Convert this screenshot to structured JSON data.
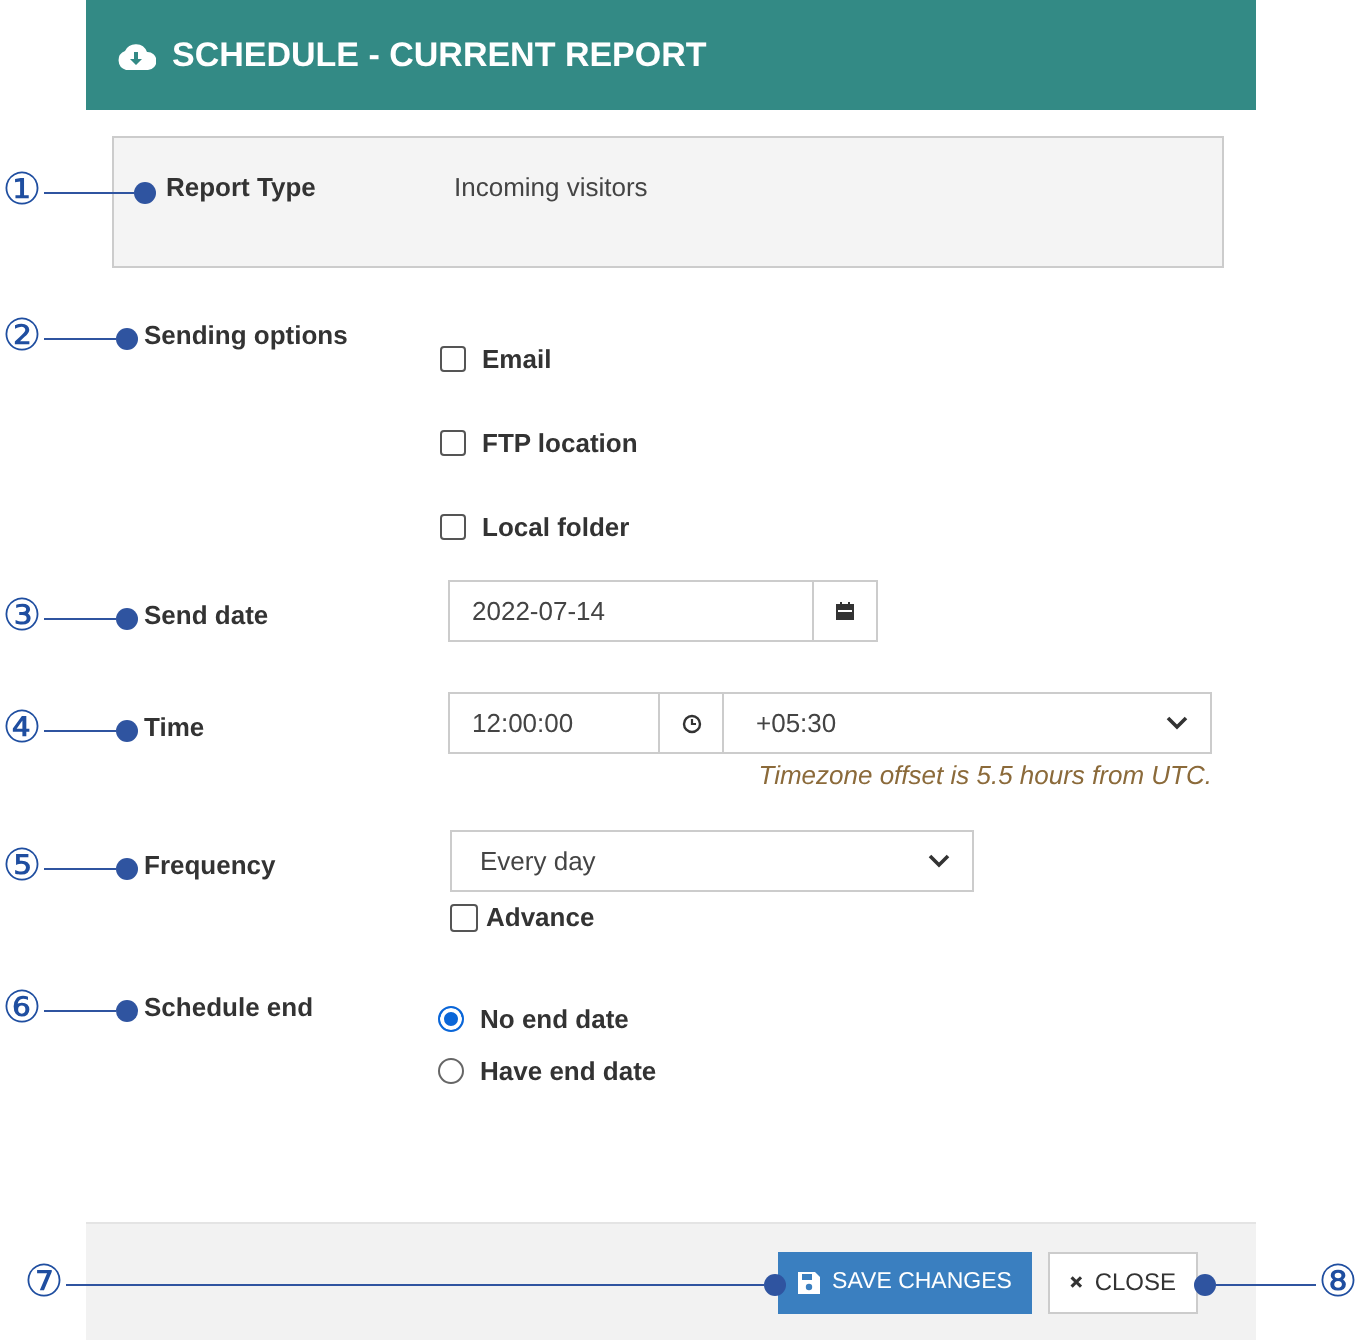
{
  "header": {
    "title": "SCHEDULE - CURRENT REPORT"
  },
  "fields": [
    {
      "kind": "info",
      "callout": "①",
      "label": "Report Type",
      "value": "Incoming visitors"
    },
    {
      "kind": "checkboxes",
      "callout": "②",
      "label": "Sending options",
      "options": [
        {
          "label": "Email",
          "checked": false
        },
        {
          "label": "FTP location",
          "checked": false
        },
        {
          "label": "Local folder",
          "checked": false
        }
      ]
    },
    {
      "kind": "date",
      "callout": "③",
      "label": "Send date",
      "value": "2022-07-14"
    },
    {
      "kind": "time",
      "callout": "④",
      "label": "Time",
      "value": "12:00:00",
      "timezone": "+05:30",
      "hint": "Timezone offset is 5.5 hours from UTC."
    },
    {
      "kind": "select",
      "callout": "⑤",
      "label": "Frequency",
      "value": "Every day",
      "advanced": {
        "label": "Advance",
        "checked": false
      }
    },
    {
      "kind": "radios",
      "callout": "⑥",
      "label": "Schedule end",
      "options": [
        {
          "label": "No end date",
          "selected": true
        },
        {
          "label": "Have end date",
          "selected": false
        }
      ]
    }
  ],
  "footer": {
    "buttons": [
      {
        "kind": "save",
        "label": "SAVE CHANGES",
        "callout": "⑦"
      },
      {
        "kind": "close",
        "label": "CLOSE",
        "callout": "⑧"
      }
    ]
  }
}
